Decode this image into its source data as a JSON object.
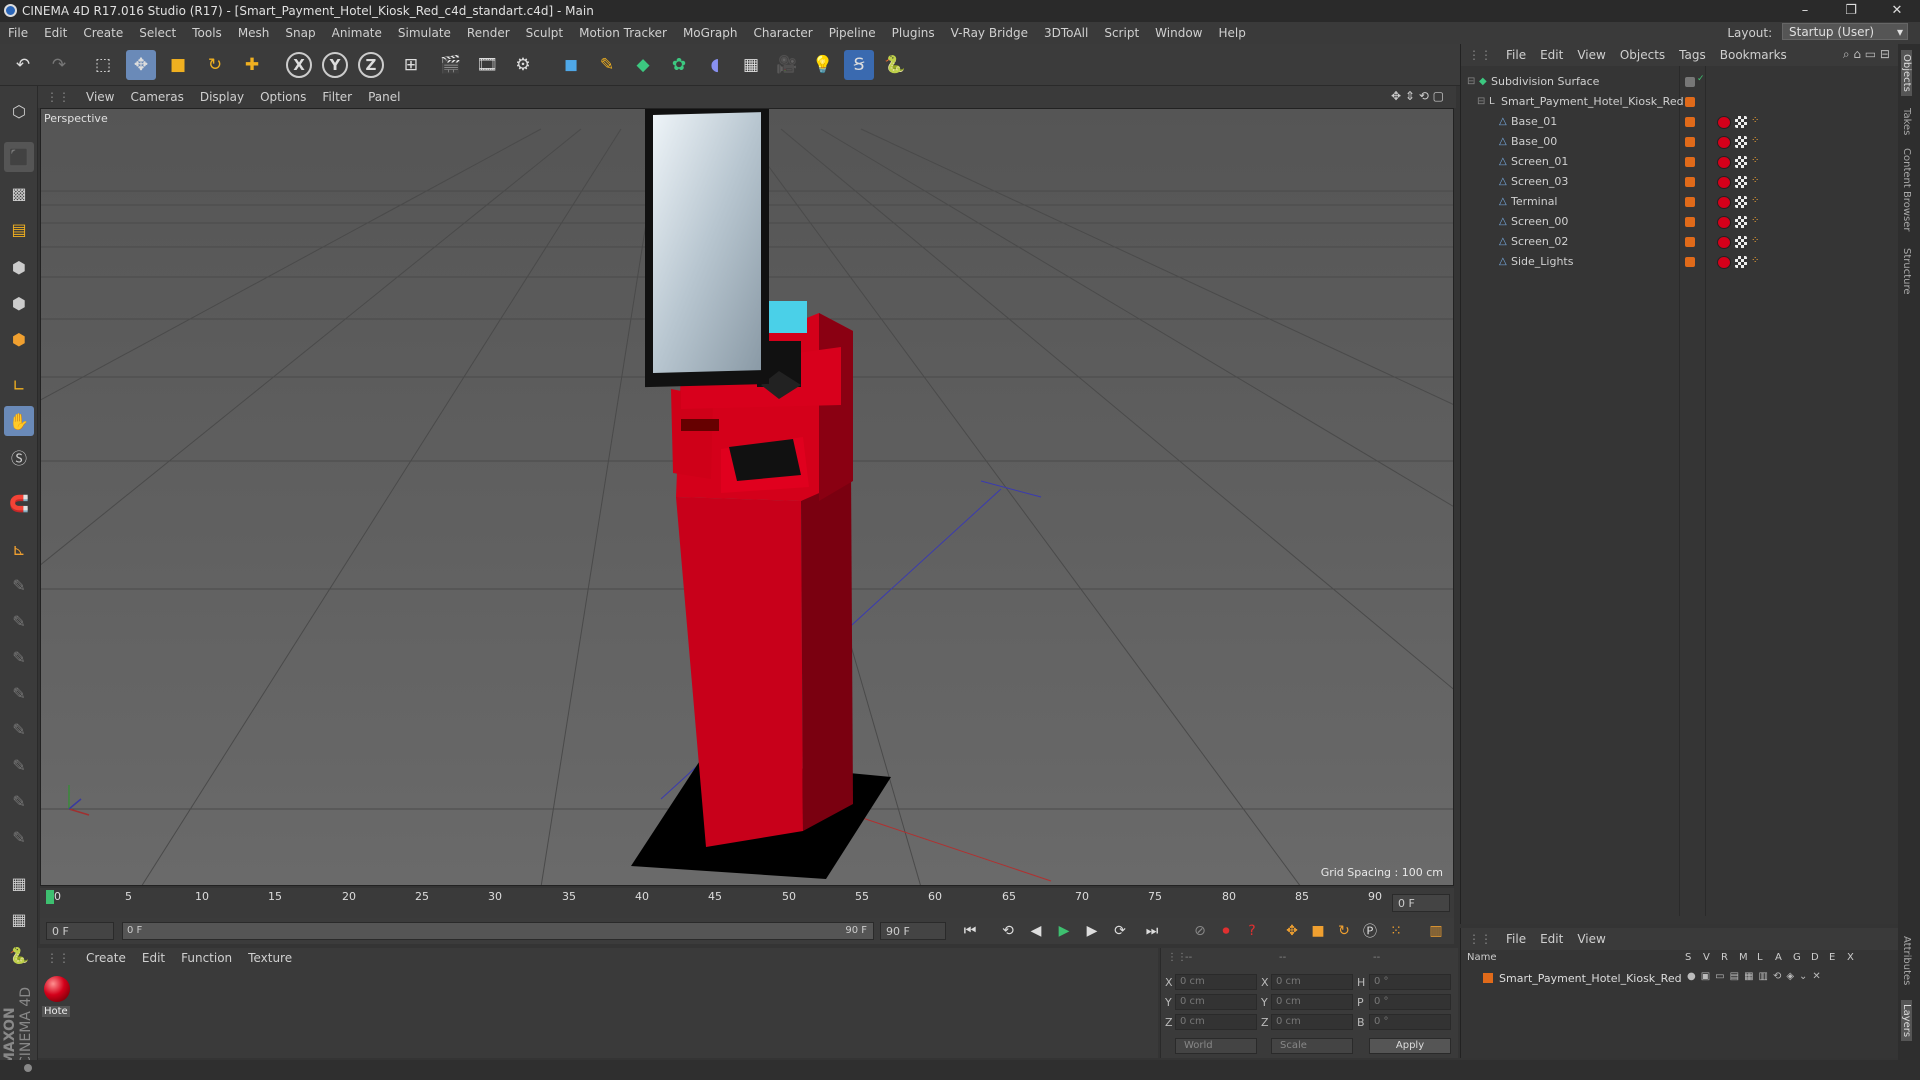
{
  "titlebar": {
    "title": "CINEMA 4D R17.016 Studio (R17) - [Smart_Payment_Hotel_Kiosk_Red_c4d_standart.c4d] - Main"
  },
  "menubar": {
    "items": [
      "File",
      "Edit",
      "Create",
      "Select",
      "Tools",
      "Mesh",
      "Snap",
      "Animate",
      "Simulate",
      "Render",
      "Sculpt",
      "Motion Tracker",
      "MoGraph",
      "Character",
      "Pipeline",
      "Plugins",
      "V-Ray Bridge",
      "3DToAll",
      "Script",
      "Window",
      "Help"
    ]
  },
  "layout": {
    "label": "Layout:",
    "value": "Startup (User)"
  },
  "viewport": {
    "menu": [
      "View",
      "Cameras",
      "Display",
      "Options",
      "Filter",
      "Panel"
    ],
    "label": "Perspective",
    "grid_spacing": "Grid Spacing : 100 cm"
  },
  "timeline": {
    "ticks": [
      "0",
      "5",
      "10",
      "15",
      "20",
      "25",
      "30",
      "35",
      "40",
      "45",
      "50",
      "55",
      "60",
      "65",
      "70",
      "75",
      "80",
      "85",
      "90"
    ],
    "end_frame": "0 F"
  },
  "transport": {
    "start": "0 F",
    "range_start": "0 F",
    "range_end": "90 F",
    "end": "90 F"
  },
  "material_manager": {
    "menu": [
      "Create",
      "Edit",
      "Function",
      "Texture"
    ],
    "material_name": "Hote"
  },
  "coords": {
    "header": [
      "--",
      "--",
      "--"
    ],
    "rows": [
      {
        "a": "X",
        "av": "0 cm",
        "b": "X",
        "bv": "0 cm",
        "c": "H",
        "cv": "0 °"
      },
      {
        "a": "Y",
        "av": "0 cm",
        "b": "Y",
        "bv": "0 cm",
        "c": "P",
        "cv": "0 °"
      },
      {
        "a": "Z",
        "av": "0 cm",
        "b": "Z",
        "bv": "0 cm",
        "c": "B",
        "cv": "0 °"
      }
    ],
    "world": "World",
    "scale": "Scale",
    "apply": "Apply"
  },
  "object_manager": {
    "menu": [
      "File",
      "Edit",
      "View",
      "Objects",
      "Tags",
      "Bookmarks"
    ],
    "objects": [
      {
        "name": "Subdivision Surface"
      },
      {
        "name": "Smart_Payment_Hotel_Kiosk_Red"
      },
      {
        "name": "Base_01"
      },
      {
        "name": "Base_00"
      },
      {
        "name": "Screen_01"
      },
      {
        "name": "Screen_03"
      },
      {
        "name": "Terminal"
      },
      {
        "name": "Screen_00"
      },
      {
        "name": "Screen_02"
      },
      {
        "name": "Side_Lights"
      }
    ]
  },
  "layer_manager": {
    "menu": [
      "File",
      "Edit",
      "View"
    ],
    "columns": [
      "Name",
      "S",
      "V",
      "R",
      "M",
      "L",
      "A",
      "G",
      "D",
      "E",
      "X"
    ],
    "layer": "Smart_Payment_Hotel_Kiosk_Red"
  },
  "side_tabs": [
    "Objects",
    "Takes",
    "Content Browser",
    "Structure",
    "Attributes",
    "Layers"
  ],
  "brand": {
    "maxon": "MAXON",
    "c4d": "CINEMA 4D"
  },
  "colors": {
    "accent": "#6a8ab8",
    "kiosk_red": "#d4001a",
    "layer_orange": "#e06a1a"
  }
}
